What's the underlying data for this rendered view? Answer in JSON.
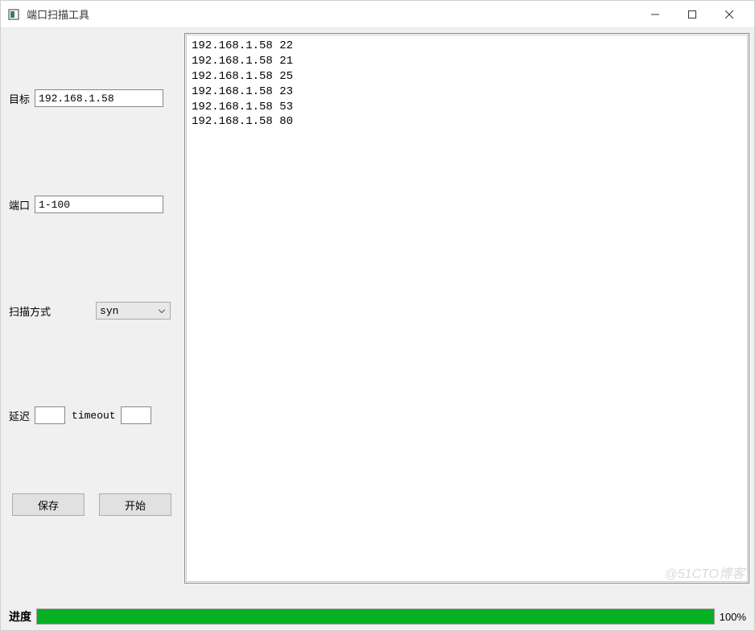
{
  "window": {
    "title": "端口扫描工具"
  },
  "form": {
    "target_label": "目标",
    "target_value": "192.168.1.58",
    "port_label": "端口",
    "port_value": "1-100",
    "scan_method_label": "扫描方式",
    "scan_method_value": "syn",
    "delay_label": "延迟",
    "delay_value": "",
    "timeout_label": "timeout",
    "timeout_value": ""
  },
  "buttons": {
    "save": "保存",
    "start": "开始"
  },
  "output": {
    "lines": [
      "192.168.1.58 22",
      "192.168.1.58 21",
      "192.168.1.58 25",
      "192.168.1.58 23",
      "192.168.1.58 53",
      "192.168.1.58 80"
    ]
  },
  "progress": {
    "label": "进度",
    "percent": 100,
    "text": "100%"
  },
  "watermark": "@51CTO博客"
}
